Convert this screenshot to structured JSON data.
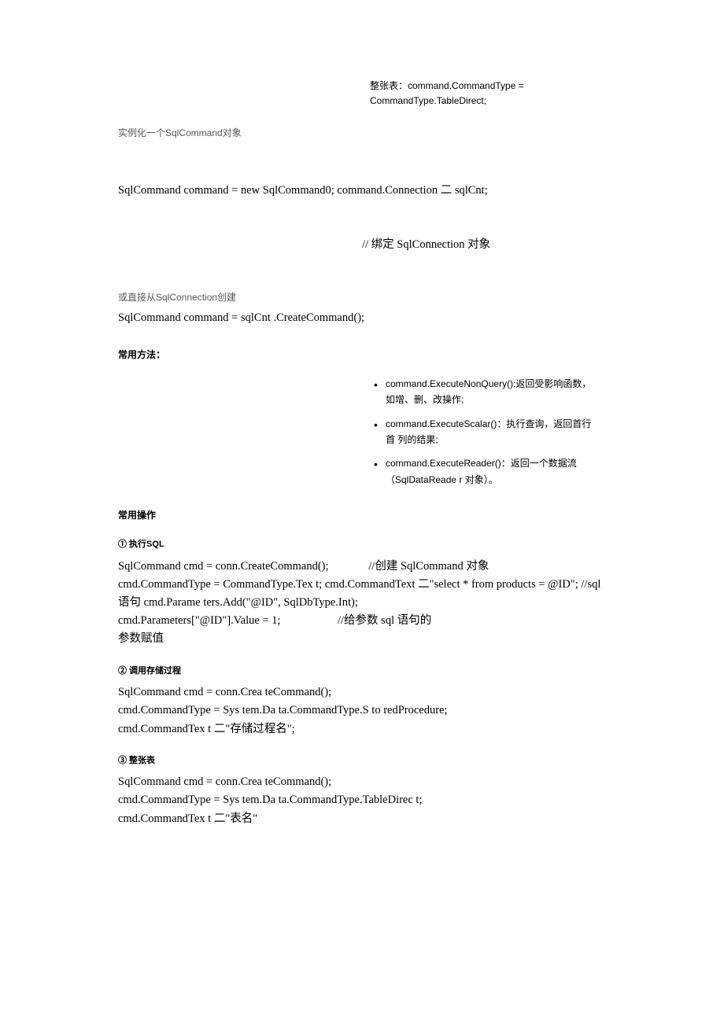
{
  "topNote": "整张表：command.CommandType = CommandType.TableDirect;",
  "instLabel": "实例化一个SqlCommand对象",
  "instCode1": "SqlCommand command = new SqlCommand0; command.Connection 二 sqlCnt;",
  "instCode2": "// 绑定 SqlConnection 对象",
  "orLabel": "或直接从SqlConnection创建",
  "orCode": "SqlCommand command = sqlCnt .CreateCommand();",
  "commonMethodsHeading": "常用方法：",
  "methods": [
    "command.ExecuteNonQuery():返回受影响函数，  如增、删、改操作;",
    "command.ExecuteScalar()：执行查询，返回首行首 列的结果;",
    "command.ExecuteReader()：返回一个数据流（SqlDataReade r 对象）。"
  ],
  "commonOpsHeading": "常用操作",
  "sec1Heading": "①  执行SQL",
  "sec1Code": "SqlCommand cmd = conn.CreateCommand();              //创建 SqlCommand 对象\ncmd.CommandType = CommandType.Tex t; cmd.CommandText 二\"select * from products = @ID\"; //sql 语句 cmd.Parame ters.Add(\"@ID\", SqlDbType.Int);\ncmd.Parameters[\"@ID\"].Value = 1;                    //给参数 sql 语句的\n参数赋值",
  "sec2Heading": "②  调用存储过程",
  "sec2Code": "SqlCommand cmd = conn.Crea teCommand();\ncmd.CommandType = Sys tem.Da ta.CommandType.S to redProcedure;\ncmd.CommandTex t 二\"存储过程名\";",
  "sec3Heading": "③  整张表",
  "sec3Code": "SqlCommand cmd = conn.Crea teCommand();\ncmd.CommandType = Sys tem.Da ta.CommandType.TableDirec t;\ncmd.CommandTex t 二\"表名\""
}
